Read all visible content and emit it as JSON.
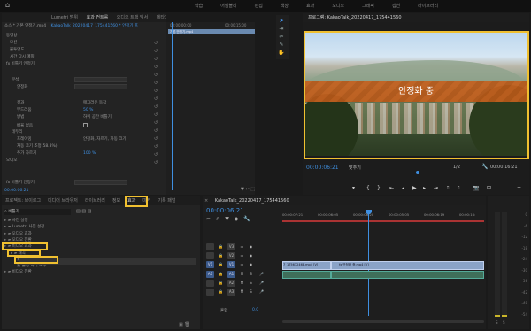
{
  "workspaces": [
    "학습",
    "어셈블리",
    "편집",
    "색상",
    "효과",
    "오디오",
    "그래픽",
    "캡션",
    "라이브러리"
  ],
  "source": {
    "tabs": [
      "Lumetri 범위",
      "효과 컨트롤",
      "오디오 트랙 믹서",
      "메타데이터"
    ],
    "clip": "소스 * 기본 안정기.mp4",
    "seq": "KakaoTalk_20220417_175441560 * 안정기 프",
    "time_a": "00:00:00:00",
    "time_b": "00:00:15:00",
    "clip_label": "기본 안정기.mp4",
    "rows": [
      "동영상",
      "모션",
      "불투명도",
      "시간 다시 매핑",
      "fx 비틀기 안정기",
      "분석",
      "안정화",
      "결과",
      "부드러움",
      "방법",
      "배율 없음",
      "테두리",
      "프레이밍",
      "자동 크기 조정(58.8%)",
      "추가 자르기",
      "오디오",
      "fx 비틀기 안정기"
    ],
    "values": [
      "매끄러운 동작",
      "50 %",
      "하위 공간 비틀기",
      "안정화, 자르기, 자동 크기",
      "100 %",
      "0.0 %"
    ],
    "bottom_time": "00:00:06:21"
  },
  "program": {
    "title": "프로그램: KakaoTalk_20220417_175441560",
    "overlay": "안정화 중",
    "tc": "00:00:06:21",
    "fit": "맞추기",
    "quality": "1/2",
    "duration": "00:00:16:21"
  },
  "project": {
    "tabs": [
      "프로젝트: 브이로그",
      "미디어 브라우저",
      "라이브러리",
      "정보",
      "효과",
      "마커",
      "기록 패널"
    ],
    "search": "비틀기",
    "tree": [
      "사전 설정",
      "Lumetri 사전 설정",
      "오디오 효과",
      "오디오 전환",
      "비디오 효과",
      "왜곡",
      "비틀기 안정기",
      "롤링 셔터 복구",
      "비디오 전환"
    ]
  },
  "timeline": {
    "title": "KakaoTalk_20220417_175441560",
    "tc": "00:00:06:21",
    "ruler": [
      "00:00:07:21",
      "00:00:06:05",
      "00:00:06:20",
      "00:00:05:05",
      "00:00:06:19",
      "00:00:16:"
    ],
    "v_tracks": [
      "V3",
      "V2",
      "V1"
    ],
    "a_tracks": [
      "A1",
      "A2",
      "A3"
    ],
    "mix": "혼합",
    "mix_val": "0.0",
    "clip_v1": "7_175632468.mp4 [V]",
    "clip_v2": "fx 안정화 중.mp4 [V]"
  },
  "meter": {
    "scale": [
      "0",
      "-6",
      "-12",
      "-18",
      "-24",
      "-30",
      "-36",
      "-42",
      "-48",
      "-54"
    ],
    "labels": [
      "S",
      "S"
    ]
  }
}
